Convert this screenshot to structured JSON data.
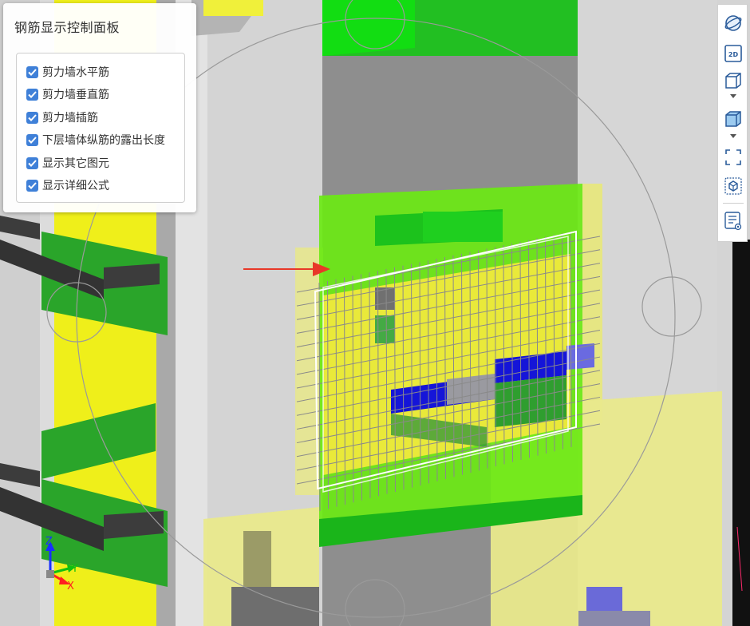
{
  "panel": {
    "title": "钢筋显示控制面板",
    "options": [
      {
        "label": "剪力墙水平筋",
        "checked": true
      },
      {
        "label": "剪力墙垂直筋",
        "checked": true
      },
      {
        "label": "剪力墙插筋",
        "checked": true
      },
      {
        "label": "下层墙体纵筋的露出长度",
        "checked": true
      },
      {
        "label": "显示其它图元",
        "checked": true
      },
      {
        "label": "显示详细公式",
        "checked": true
      }
    ]
  },
  "toolbar": {
    "view_2d_label": "2D",
    "icons": [
      "orbit-icon",
      "view-2d-icon",
      "wireframe-cube-icon",
      "solid-cube-icon",
      "fit-view-icon",
      "isometric-view-icon",
      "properties-list-icon"
    ]
  },
  "axes": {
    "x_label": "X",
    "y_label": "Y",
    "z_label": "Z",
    "x_color": "#ff2020",
    "y_color": "#10c010",
    "z_color": "#1a30ff"
  },
  "colors": {
    "accent": "#3f80d8",
    "arrow": "#e83828",
    "wall_yellow": "#f0f000",
    "slab_green": "#2aa52a",
    "highlight_green": "#66ee11",
    "column_gray": "#8c8c8c",
    "rebar_blue": "#1515d8"
  }
}
